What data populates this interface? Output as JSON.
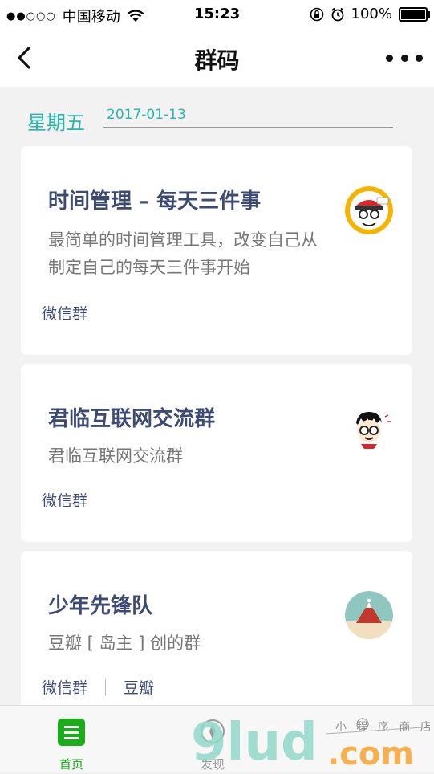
{
  "status_bar": {
    "signal": "●●○○○",
    "carrier": "中国移动",
    "time": "15:23",
    "battery": "100%",
    "battery_level": 1.0
  },
  "nav": {
    "title": "群码"
  },
  "date_header": {
    "weekday": "星期五",
    "date": "2017-01-13"
  },
  "groups": [
    {
      "title": "时间管理 – 每天三件事",
      "description": "最简单的时间管理工具，改变自己从制定自己的每天三件事开始",
      "tags": [
        "微信群"
      ]
    },
    {
      "title": "君临互联网交流群",
      "description": "君临互联网交流群",
      "tags": [
        "微信群"
      ]
    },
    {
      "title": "少年先锋队",
      "description": "豆瓣 [ 岛主 ] 创的群",
      "tags": [
        "微信群",
        "豆瓣"
      ]
    }
  ],
  "tabbar": {
    "home_label": "首页",
    "find_label": "发现"
  },
  "watermark": {
    "brand": "9lud",
    "suffix": ".com",
    "tagline": "小 程 序 商 店"
  },
  "colors": {
    "accent_teal": "#26b7aa",
    "title_navy": "#3d4a72",
    "tab_green": "#1aad19"
  }
}
